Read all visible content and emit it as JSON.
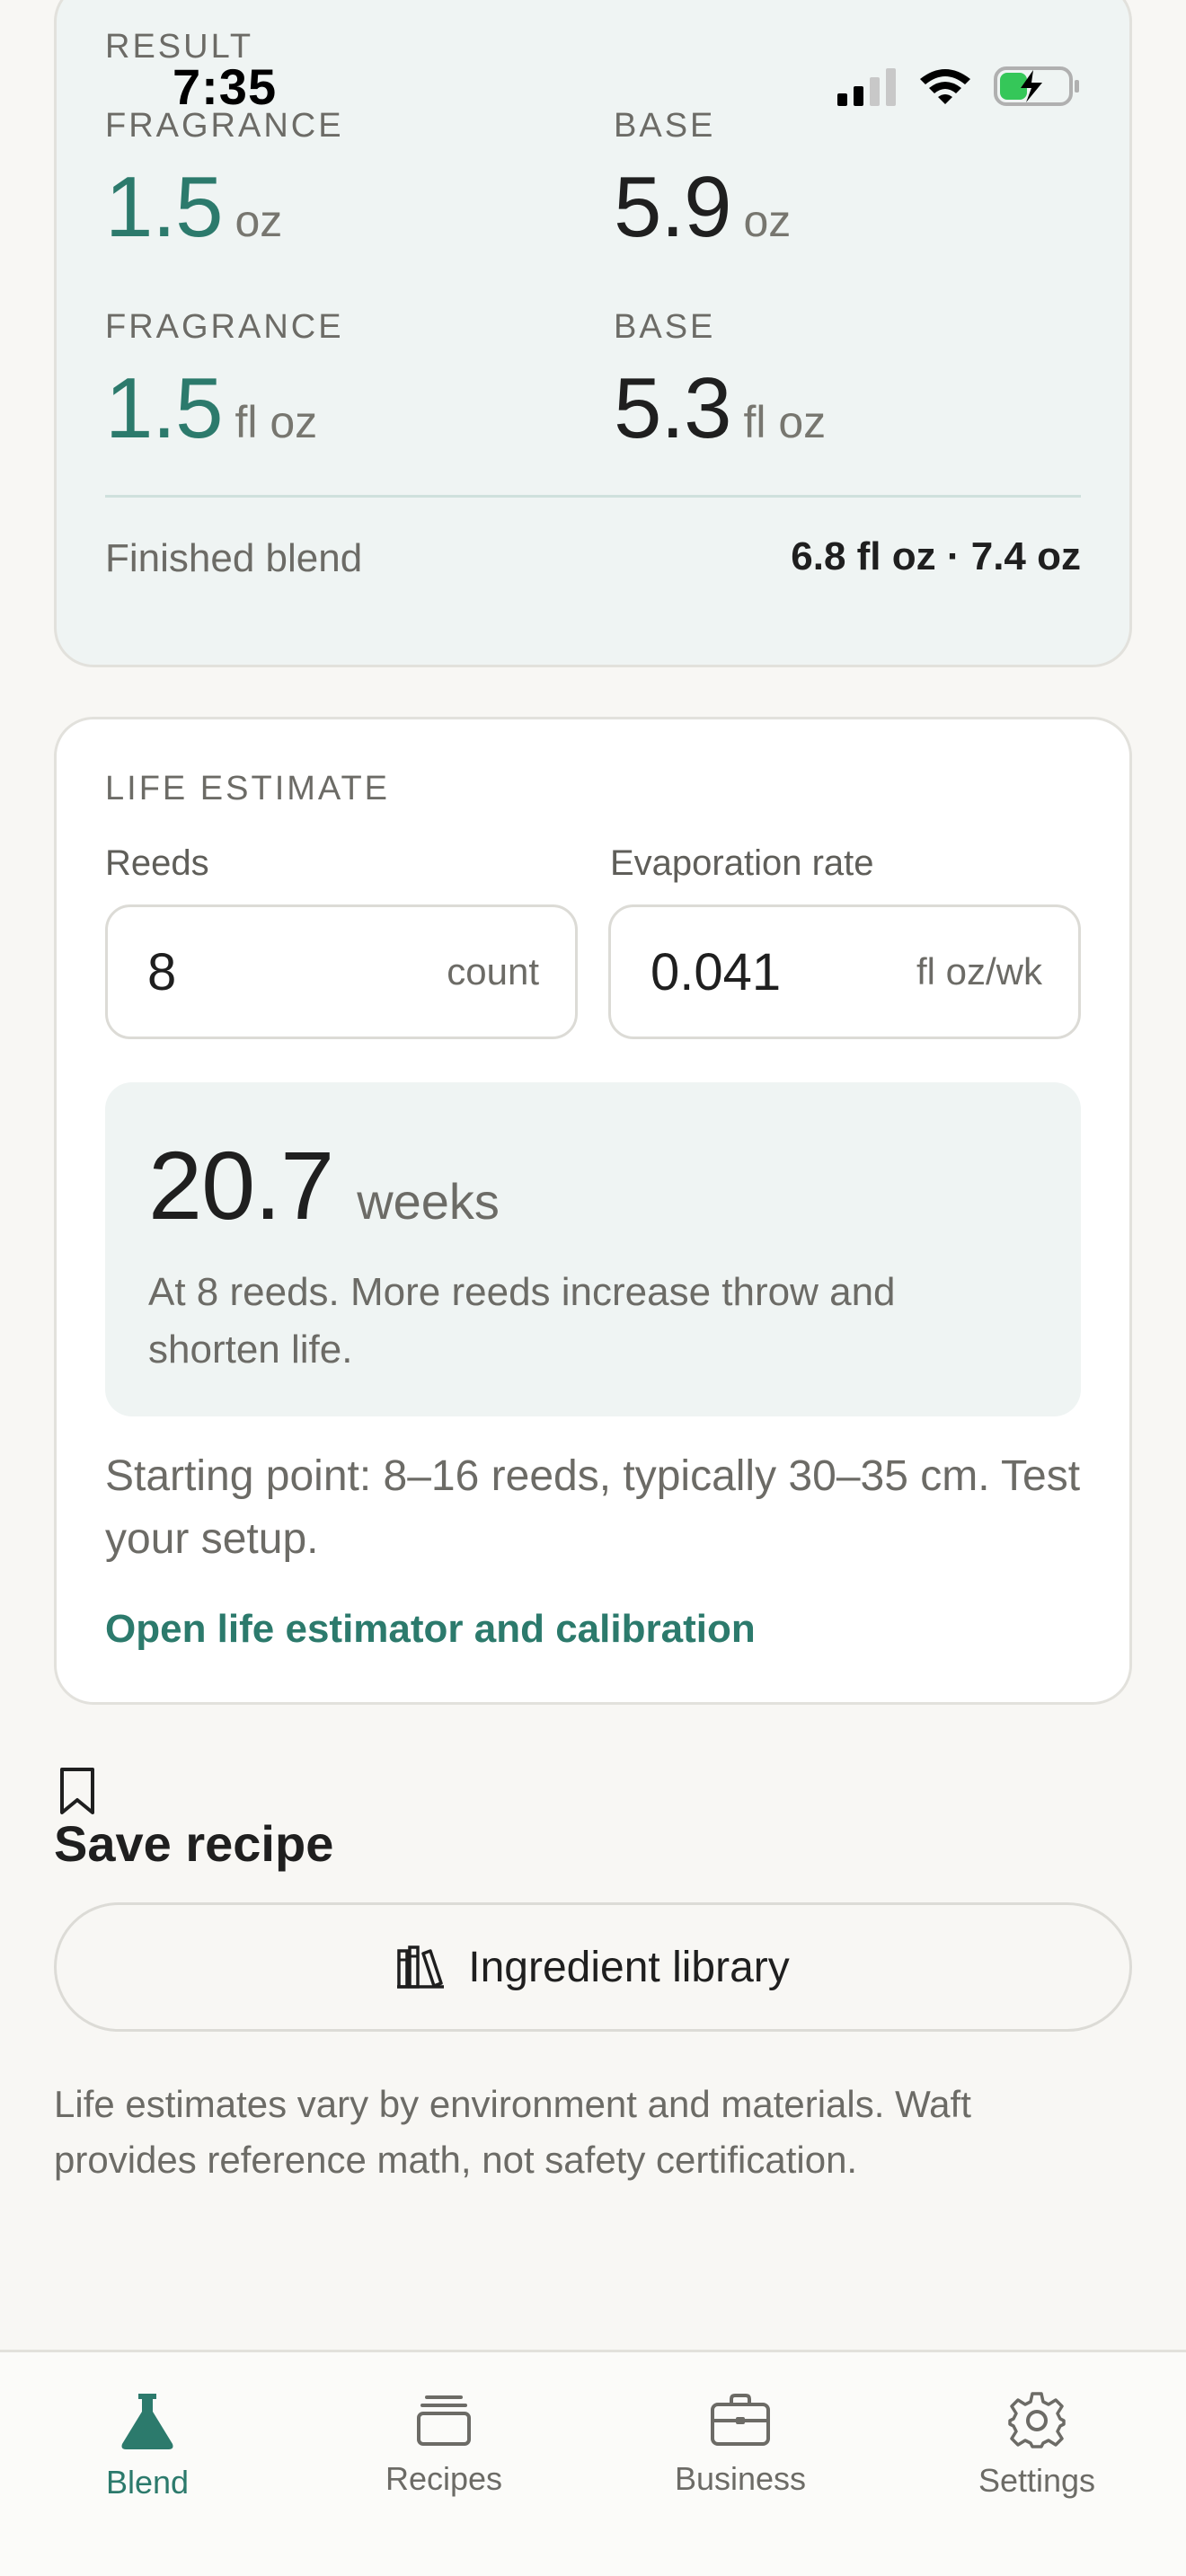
{
  "status_bar": {
    "time": "7:35"
  },
  "result": {
    "label": "RESULT",
    "weight": {
      "fragrance_label": "FRAGRANCE",
      "fragrance_value": "1.5",
      "fragrance_unit": "oz",
      "base_label": "BASE",
      "base_value": "5.9",
      "base_unit": "oz"
    },
    "volume": {
      "fragrance_label": "FRAGRANCE",
      "fragrance_value": "1.5",
      "fragrance_unit": "fl oz",
      "base_label": "BASE",
      "base_value": "5.3",
      "base_unit": "fl oz"
    },
    "finished_label": "Finished blend",
    "finished_value": "6.8 fl oz · 7.4 oz"
  },
  "life_estimate": {
    "title": "LIFE ESTIMATE",
    "reeds_label": "Reeds",
    "reeds_value": "8",
    "reeds_unit": "count",
    "evap_label": "Evaporation rate",
    "evap_value": "0.041",
    "evap_unit": "fl oz/wk",
    "estimate_value": "20.7",
    "estimate_unit": "weeks",
    "estimate_note": "At 8 reeds. More reeds increase throw and shorten life.",
    "starting_point": "Starting point: 8–16 reeds, typically 30–35 cm. Test your setup.",
    "link": "Open life estimator and calibration"
  },
  "save": {
    "title": "Save recipe",
    "library_button": "Ingredient library",
    "icons": {
      "bookmark": "bookmark-icon",
      "library": "books-icon"
    }
  },
  "disclaimer": "Life estimates vary by environment and materials. Waft provides reference math, not safety certification.",
  "tabs": [
    {
      "label": "Blend",
      "icon": "flask-icon",
      "active": true
    },
    {
      "label": "Recipes",
      "icon": "stack-icon",
      "active": false
    },
    {
      "label": "Business",
      "icon": "briefcase-icon",
      "active": false
    },
    {
      "label": "Settings",
      "icon": "gear-icon",
      "active": false
    }
  ],
  "colors": {
    "accent": "#2c7a6c",
    "background": "#f8f7f4",
    "result_bg": "#eff4f3"
  }
}
